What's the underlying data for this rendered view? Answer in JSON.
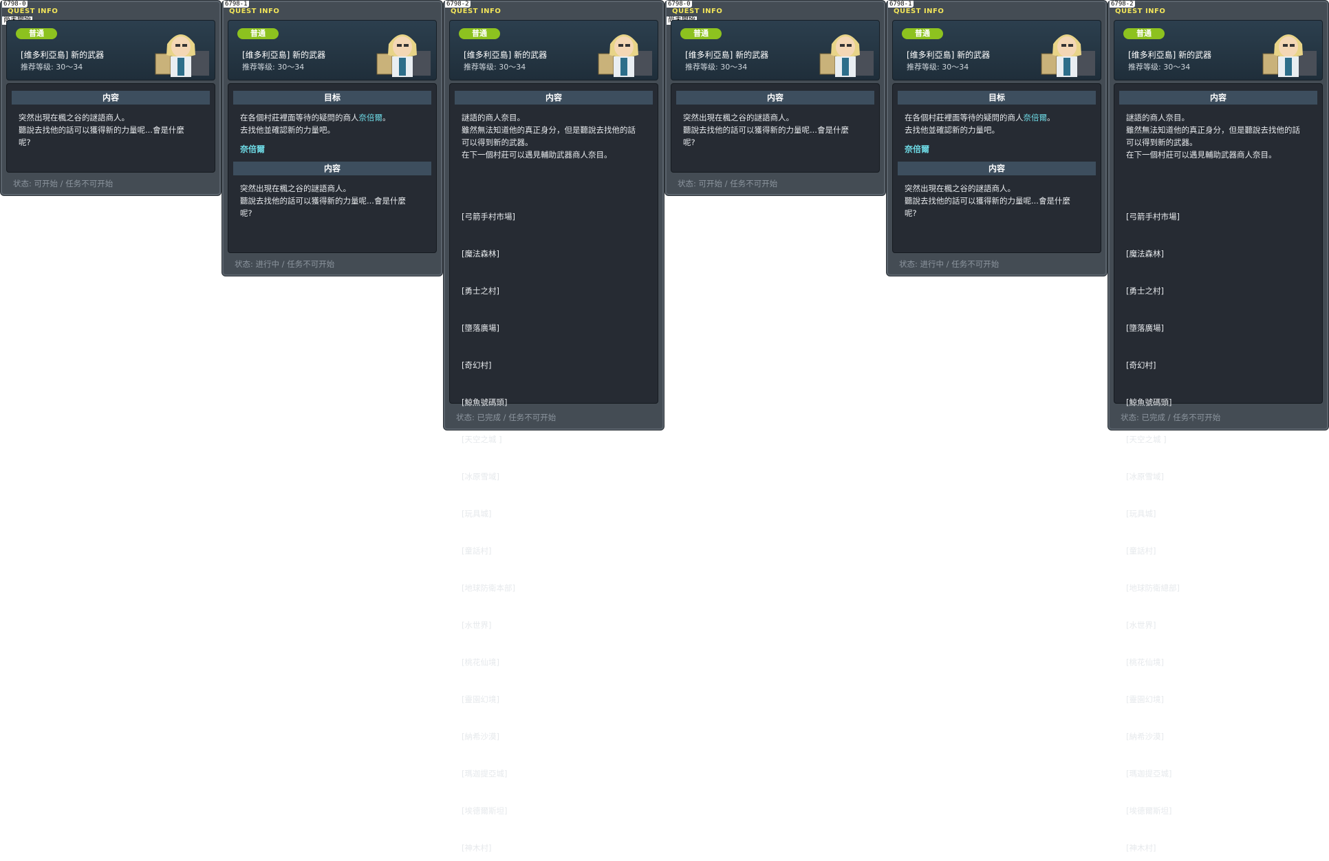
{
  "panels": [
    {
      "id": "6798-0",
      "title": "QUEST INFO",
      "subtitle": "尚未開始",
      "badge": "普通",
      "name": "[维多利亞島] 新的武器",
      "level": "推荐等级: 30～34",
      "section_title": "内容",
      "content": "突然出現在楓之谷的謎語商人。\n聽說去找他的話可以獲得新的力量呢...會是什麼\n呢?",
      "status": "状态: 可开始 / 任务不可开始"
    },
    {
      "id": "6798-1",
      "title": "QUEST INFO",
      "subtitle": "",
      "badge": "普通",
      "name": "[维多利亞島] 新的武器",
      "level": "推荐等级: 30～34",
      "goal_title": "目标",
      "goal_pre": "在各個村莊裡面等待的疑問的商人",
      "goal_npc": "奈倍爾",
      "goal_post": "。\n去找他並確認新的力量吧。",
      "npc_name": "奈倍爾",
      "section_title": "内容",
      "content": "突然出現在楓之谷的謎語商人。\n聽說去找他的話可以獲得新的力量呢...會是什麼\n呢?",
      "status": "状态: 进行中 / 任务不可开始"
    },
    {
      "id": "6798-2",
      "title": "QUEST INFO",
      "subtitle": "",
      "badge": "普通",
      "name": "[维多利亞島] 新的武器",
      "level": "推荐等级: 30～34",
      "section_title": "内容",
      "content": "謎語的商人奈目。\n雖然無法知道他的真正身分，但是聽說去找他的話\n可以得到新的武器。\n在下一個村莊可以遇見輔助武器商人奈目。",
      "places": [
        "[弓箭手村市場]",
        "[魔法森林]",
        "[勇士之村]",
        "[墮落廣場]",
        "[奇幻村]",
        "[鯨魚號碼頭]",
        "[天空之城 ]",
        "[冰原雪域]",
        "[玩具城]",
        "[童話村]",
        "[地球防衛本部]",
        "[水世界]",
        "[桃花仙境]",
        "[靈園幻境]",
        "[納希沙漠]",
        "[瑪迦提亞城]",
        "[埃德爾斯坦]",
        "[神木村]"
      ],
      "status": "状态: 已完成 / 任务不可开始"
    },
    {
      "id": "6798-0",
      "title": "QUEST INFO",
      "subtitle": "尚未開始",
      "badge": "普通",
      "name": "[维多利亞島] 新的武器",
      "level": "推荐等级: 30～34",
      "section_title": "内容",
      "content": "突然出現在楓之谷的謎語商人。\n聽說去找他的話可以獲得新的力量呢...會是什麼\n呢?",
      "status": "状态: 可开始 / 任务不可开始"
    },
    {
      "id": "6798-1",
      "title": "QUEST INFO",
      "subtitle": "",
      "badge": "普通",
      "name": "[维多利亞島] 新的武器",
      "level": "推荐等级: 30～34",
      "goal_title": "目标",
      "goal_pre": "在各個村莊裡面等待的疑問的商人",
      "goal_npc": "奈倍爾",
      "goal_post": "。\n去找他並確認新的力量吧。",
      "npc_name": "奈倍爾",
      "section_title": "内容",
      "content": "突然出現在楓之谷的謎語商人。\n聽說去找他的話可以獲得新的力量呢...會是什麼\n呢?",
      "status": "状态: 进行中 / 任务不可开始"
    },
    {
      "id": "6798-2",
      "title": "QUEST INFO",
      "subtitle": "",
      "badge": "普通",
      "name": "[维多利亞島] 新的武器",
      "level": "推荐等级: 30～34",
      "section_title": "内容",
      "content": "謎語的商人奈目。\n雖然無法知道他的真正身分，但是聽說去找他的話\n可以得到新的武器。\n在下一個村莊可以遇見輔助武器商人奈目。",
      "places": [
        "[弓箭手村市場]",
        "[魔法森林]",
        "[勇士之村]",
        "[墮落廣場]",
        "[奇幻村]",
        "[鯨魚號碼頭]",
        "[天空之城 ]",
        "[冰原雪域]",
        "[玩具城]",
        "[童話村]",
        "[地球防衛總部]",
        "[水世界]",
        "[桃花仙境]",
        "[靈園幻境]",
        "[納希沙漠]",
        "[瑪迦提亞城]",
        "[埃德爾斯坦]",
        "[神木村]"
      ],
      "status": "状态: 已完成 / 任务不可开始"
    }
  ],
  "colors": {
    "badge": "#8dc21f",
    "title": "#f2e55a",
    "highlight": "#6fdde8",
    "panel": "#444c54",
    "body": "#262b33"
  },
  "icons": {
    "npc": "npc-portrait-icon"
  }
}
